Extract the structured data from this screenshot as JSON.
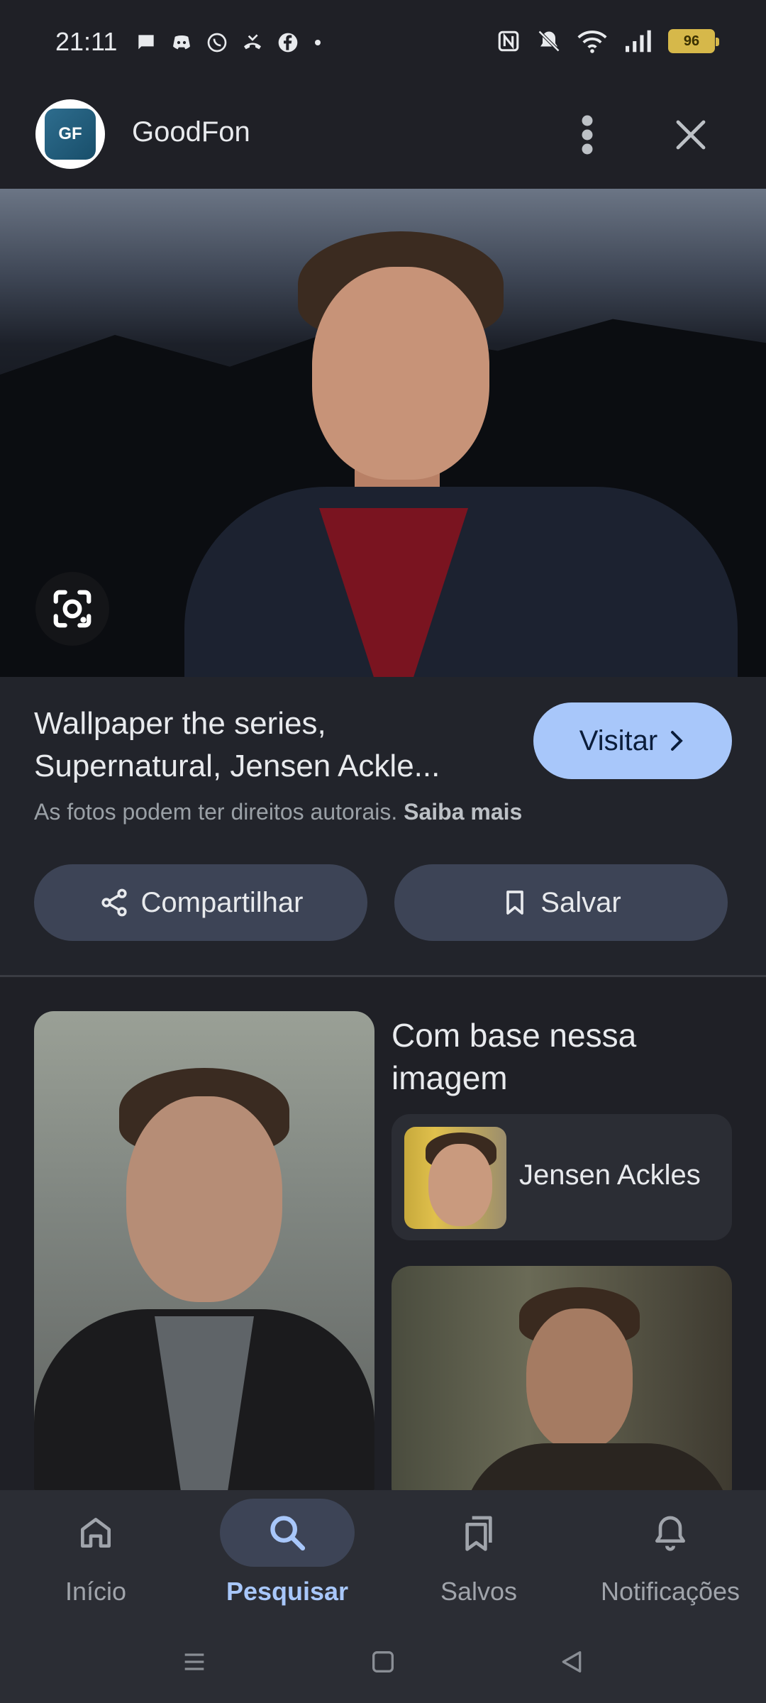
{
  "status_bar": {
    "time": "21:11",
    "battery": "96"
  },
  "header": {
    "logo_text": "GF",
    "site_name": "GoodFon"
  },
  "result": {
    "title": "Wallpaper the series, Supernatural, Jensen Ackle...",
    "visit_label": "Visitar",
    "copyright_text": "As fotos podem ter direitos autorais.",
    "learn_more": "Saiba mais",
    "share_label": "Compartilhar",
    "save_label": "Salvar"
  },
  "related": {
    "heading": "Com base nessa imagem",
    "entity_label": "Jensen Ackles"
  },
  "bottom_nav": {
    "items": [
      {
        "label": "Início",
        "icon": "home-icon"
      },
      {
        "label": "Pesquisar",
        "icon": "search-icon"
      },
      {
        "label": "Salvos",
        "icon": "saved-icon"
      },
      {
        "label": "Notificações",
        "icon": "bell-icon"
      }
    ],
    "active_index": 1
  },
  "colors": {
    "background": "#1f2026",
    "accent": "#a8c7fa",
    "button_bg": "#3d4456"
  }
}
